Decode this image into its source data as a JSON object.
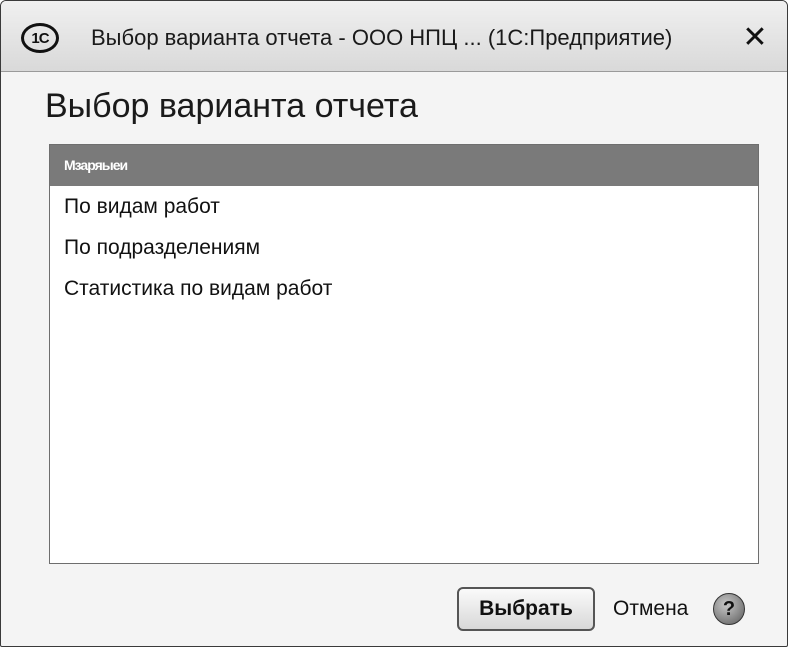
{
  "window": {
    "title": "Выбор варианта отчета - ООО НПЦ ...  (1С:Предприятие)",
    "app_logo_text": "1С",
    "close_glyph": "✕",
    "close_icon": "close-icon"
  },
  "form": {
    "heading": "Выбор варианта отчета"
  },
  "list": {
    "header_label": "Мзаряыеи",
    "items": [
      {
        "label": "По видам работ"
      },
      {
        "label": "По подразделениям"
      },
      {
        "label": "Статистика по видам работ"
      }
    ]
  },
  "footer": {
    "select_label": "Выбрать",
    "cancel_label": "Отмена",
    "help_glyph": "?",
    "help_icon": "question-mark-icon"
  },
  "colors": {
    "list_header_bg": "#7a7a7a",
    "window_bg": "#f4f4f4"
  }
}
